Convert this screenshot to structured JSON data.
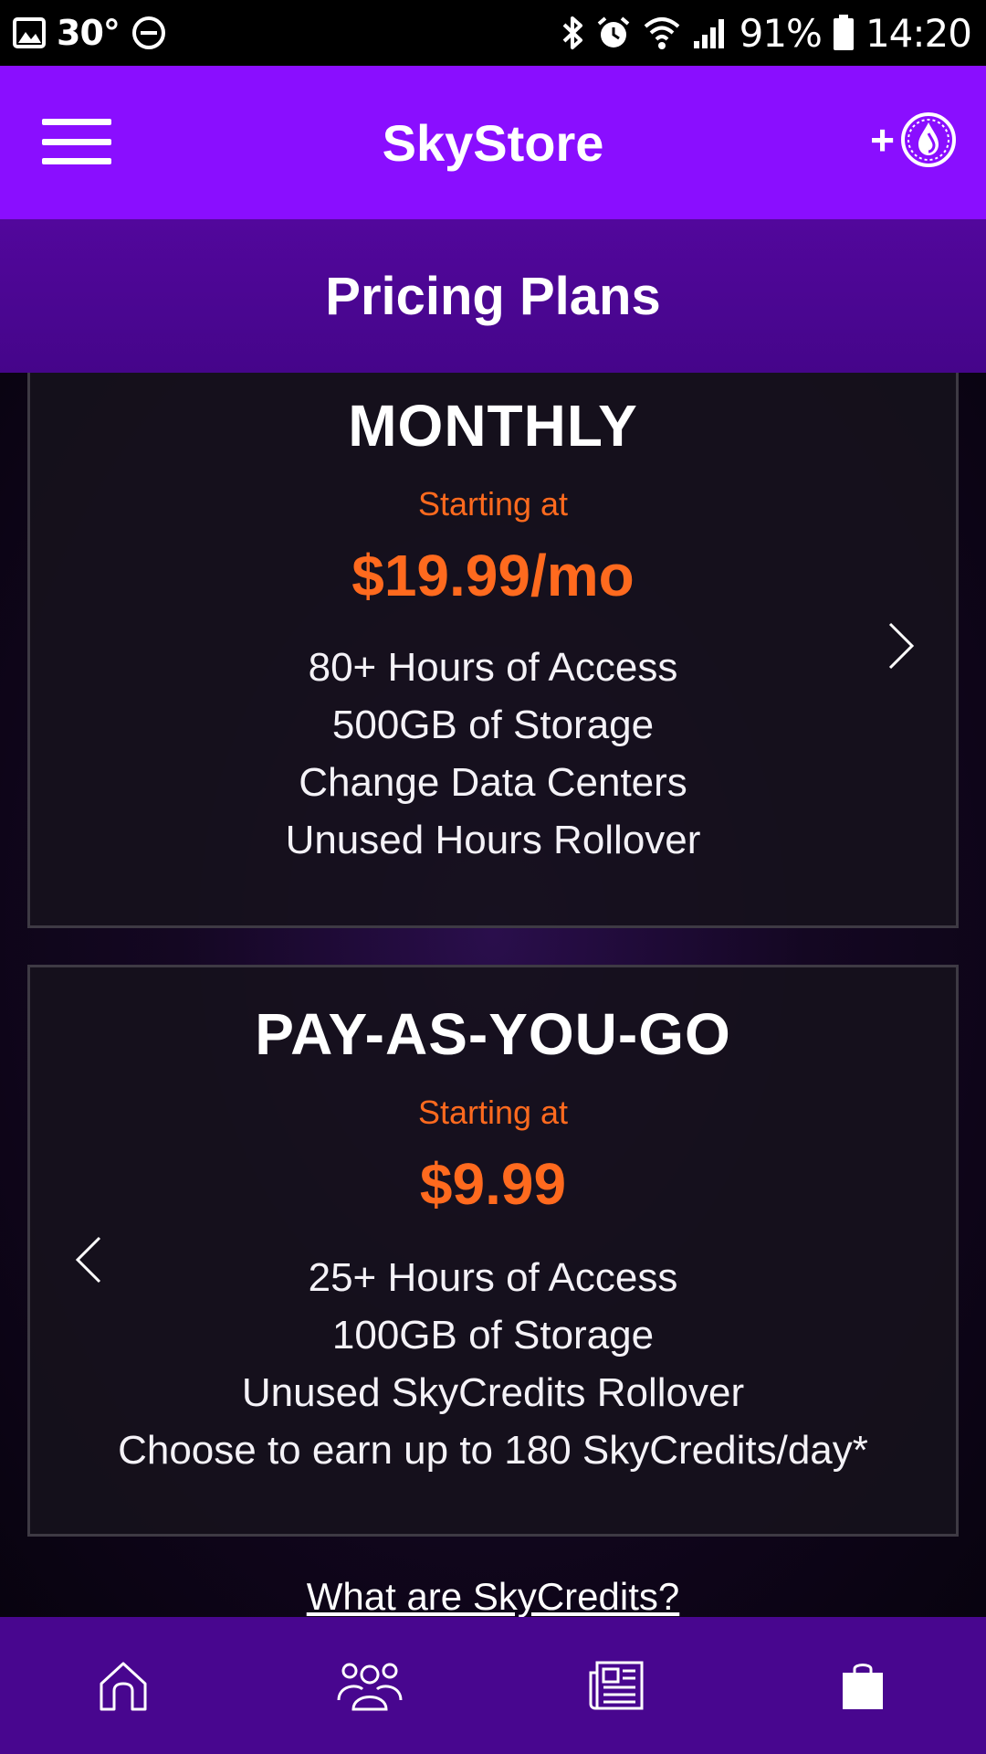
{
  "status_bar": {
    "temperature": "30°",
    "battery": "91%",
    "time": "14:20",
    "icons": [
      "image-icon",
      "do-not-disturb-icon",
      "bluetooth-icon",
      "alarm-icon",
      "wifi-icon",
      "signal-icon",
      "battery-icon"
    ]
  },
  "app_bar": {
    "title": "SkyStore",
    "menu_icon": "hamburger-menu-icon",
    "credits_plus": "+",
    "credits_icon": "skycredits-coin-icon"
  },
  "sub_header": {
    "title": "Pricing Plans"
  },
  "plans": [
    {
      "name": "MONTHLY",
      "starting_label": "Starting at",
      "price": "$19.99/mo",
      "features": [
        "80+ Hours of Access",
        "500GB of Storage",
        "Change Data Centers",
        "Unused Hours Rollover"
      ]
    },
    {
      "name": "PAY-AS-YOU-GO",
      "starting_label": "Starting at",
      "price": "$9.99",
      "features": [
        "25+ Hours of Access",
        "100GB of Storage",
        "Unused SkyCredits Rollover",
        "Choose to earn up to 180 SkyCredits/day*"
      ]
    }
  ],
  "skycredits_link": "What are SkyCredits?",
  "bottom_nav": {
    "items": [
      "home-icon",
      "community-icon",
      "news-icon",
      "store-icon"
    ]
  },
  "colors": {
    "app_bar": "#8a0eff",
    "sub_header": "#4b0792",
    "price_accent": "#ff6a1e",
    "bottom_nav": "#48068f"
  }
}
